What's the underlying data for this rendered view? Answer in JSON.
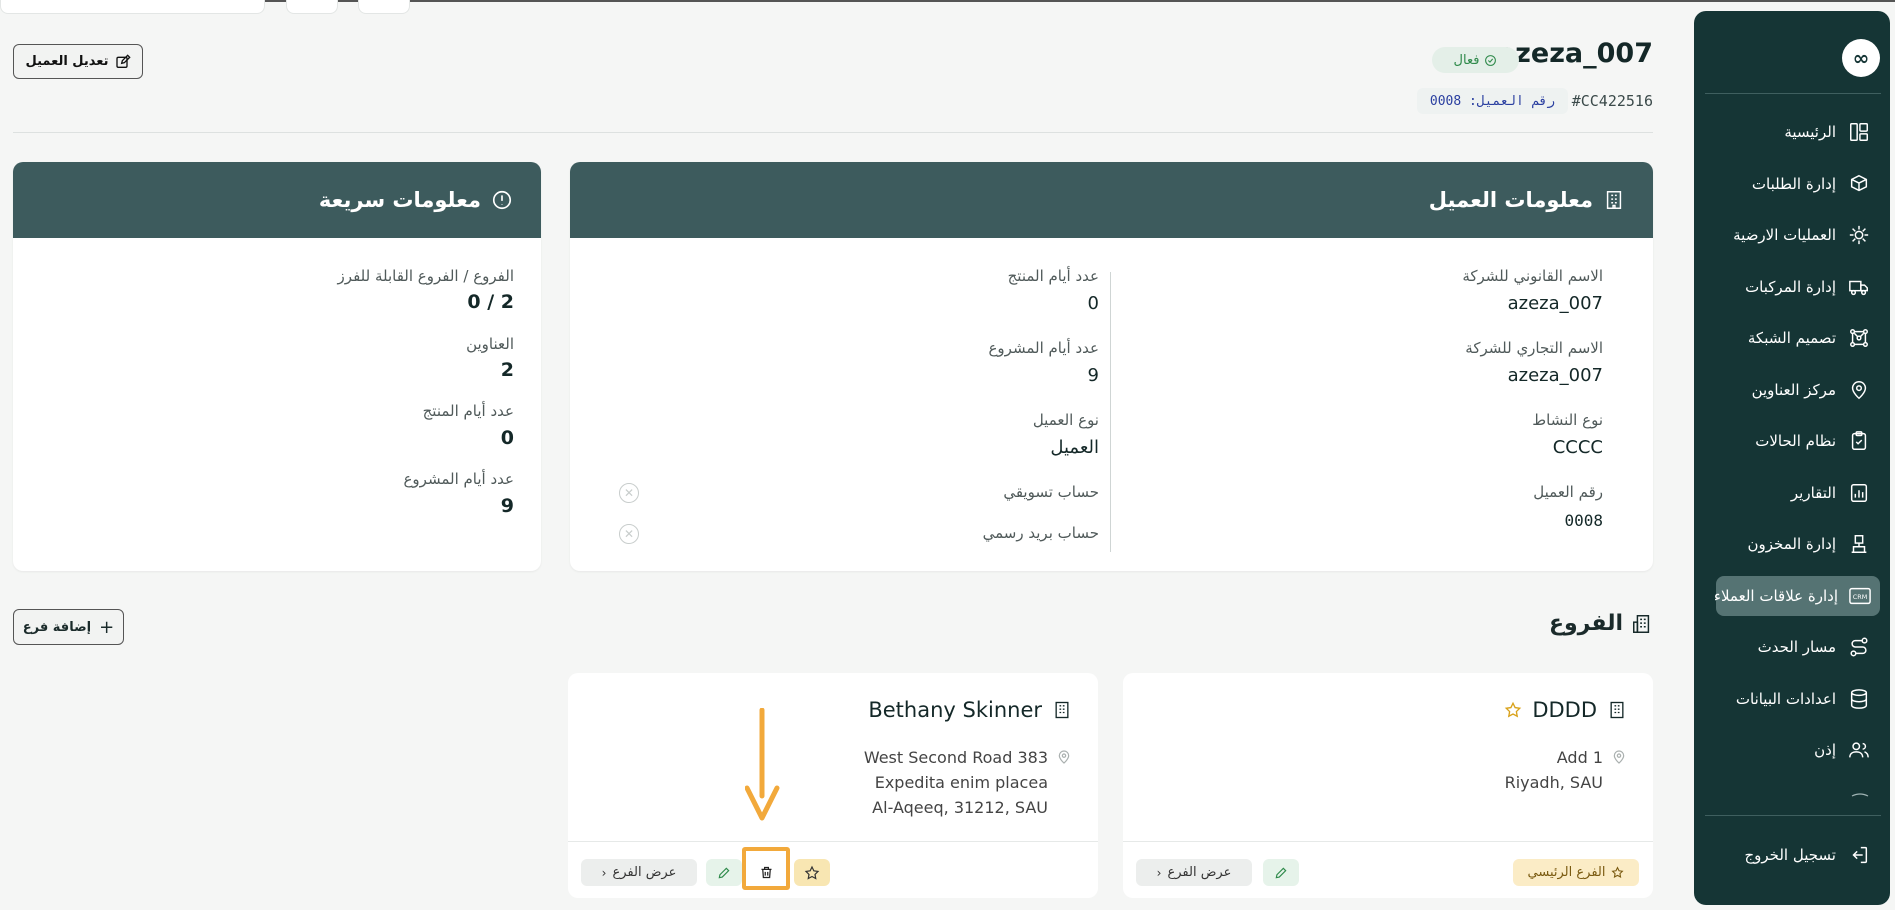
{
  "header": {
    "customer_name": "azeza_007",
    "status": "فعال",
    "code": "#CC422516",
    "customer_number": "رقم العميل: 0008",
    "edit_button": "تعديل العميل"
  },
  "sidebar": {
    "logo": "∞",
    "items": [
      {
        "label": "الرئيسية",
        "icon": "dashboard-icon"
      },
      {
        "label": "إدارة الطلبات",
        "icon": "orders-icon"
      },
      {
        "label": "العمليات الارضية",
        "icon": "ground-ops-icon"
      },
      {
        "label": "إدارة المركبات",
        "icon": "truck-icon"
      },
      {
        "label": "تصميم الشبكة",
        "icon": "network-icon"
      },
      {
        "label": "مركز العناوين",
        "icon": "address-icon"
      },
      {
        "label": "نظام الحالات",
        "icon": "status-icon"
      },
      {
        "label": "التقارير",
        "icon": "reports-icon"
      },
      {
        "label": "إدارة المخزون",
        "icon": "inventory-icon"
      },
      {
        "label": "إدارة علاقات العملاء",
        "icon": "crm-icon"
      },
      {
        "label": "مسار الحدث",
        "icon": "event-path-icon"
      },
      {
        "label": "اعدادات البيانات",
        "icon": "database-icon"
      },
      {
        "label": "إذن",
        "icon": "users-icon"
      }
    ],
    "active_index": 9,
    "logout": "تسجيل الخروج"
  },
  "customer_info": {
    "title": "معلومات العميل",
    "legal_name_label": "الاسم القانوني للشركة",
    "legal_name": "azeza_007",
    "trade_name_label": "الاسم التجاري للشركة",
    "trade_name": "azeza_007",
    "activity_label": "نوع النشاط",
    "activity": "CCCC",
    "number_label": "رقم العميل",
    "number": "0008",
    "product_days_label": "عدد أيام المنتج",
    "product_days": "0",
    "project_days_label": "عدد أيام المشروع",
    "project_days": "9",
    "type_label": "نوع العميل",
    "type": "العميل",
    "marketing_label": "حساب تسويقي",
    "official_mail_label": "حساب بريد رسمي"
  },
  "quick_info": {
    "title": "معلومات سريعة",
    "branches_label": "الفروع / الفروع القابلة للفرز",
    "branches": "0 / 2",
    "addresses_label": "العناوين",
    "addresses": "2",
    "product_days_label": "عدد أيام المنتج",
    "product_days": "0",
    "project_days_label": "عدد أيام المشروع",
    "project_days": "9"
  },
  "branches": {
    "title": "الفروع",
    "add_button": "إضافة فرع",
    "view_label": "عرض الفرع",
    "main_badge": "الفرع الرئيسي",
    "items": [
      {
        "name": "DDDD",
        "address": [
          "Add 1",
          "Riyadh, SAU"
        ],
        "is_main": true
      },
      {
        "name": "Bethany Skinner",
        "address": [
          "West Second Road 383",
          "Expedita enim placea",
          "Al-Aqeeq, 31212, SAU"
        ],
        "is_main": false
      }
    ]
  },
  "colors": {
    "sidebar": "#153535",
    "card_header": "#3d5b5d",
    "highlight": "#f2a93b",
    "status_green": "#2f8a4b"
  }
}
